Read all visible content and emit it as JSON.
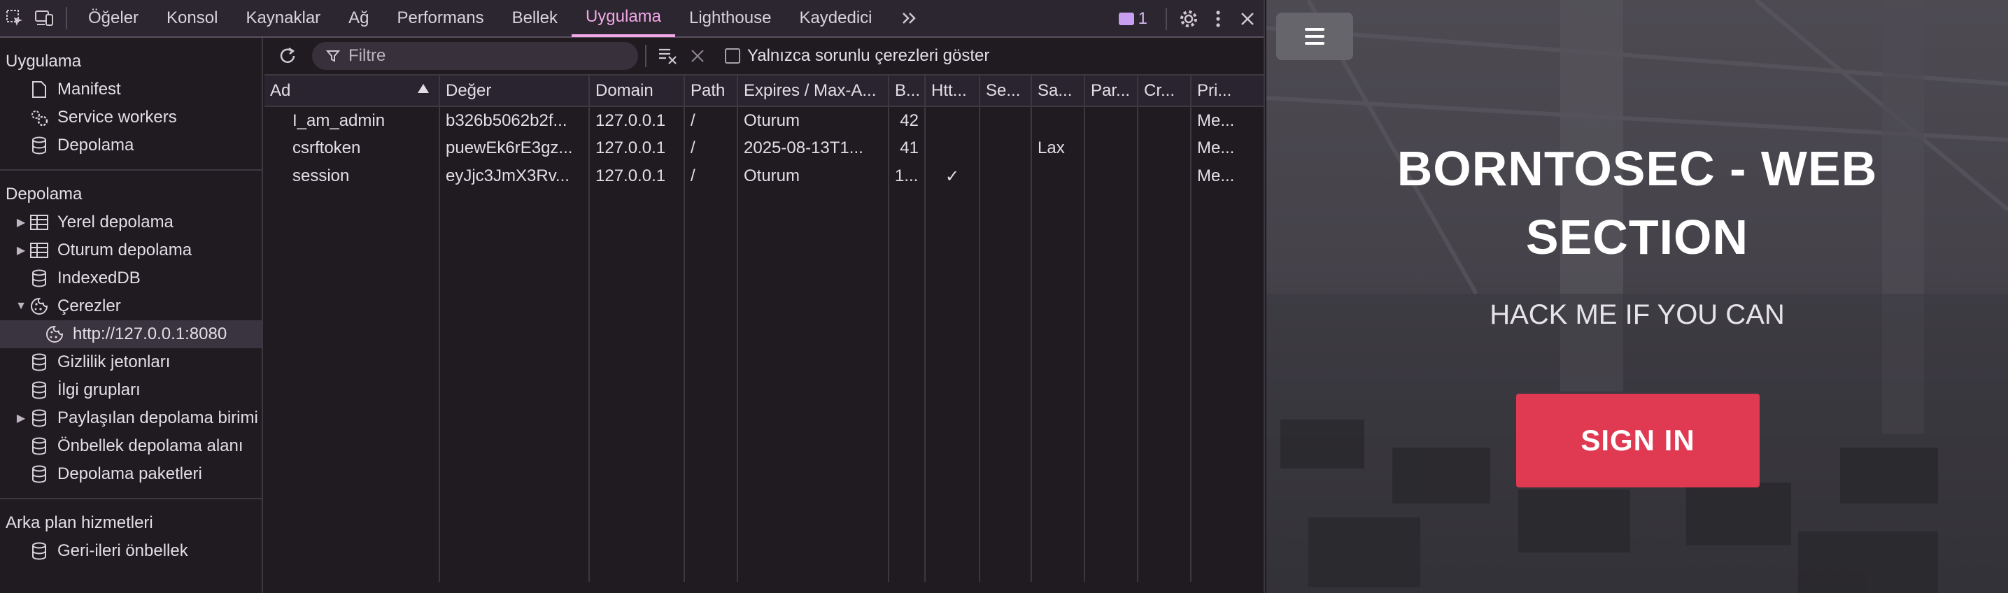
{
  "tabs": [
    "Öğeler",
    "Konsol",
    "Kaynaklar",
    "Ağ",
    "Performans",
    "Bellek",
    "Uygulama",
    "Lighthouse",
    "Kaydedici"
  ],
  "active_tab": "Uygulama",
  "issues_count": "1",
  "sidebar": {
    "sections": [
      {
        "title": "Uygulama",
        "items": [
          {
            "label": "Manifest",
            "icon": "document-icon"
          },
          {
            "label": "Service workers",
            "icon": "gears-icon"
          },
          {
            "label": "Depolama",
            "icon": "database-icon"
          }
        ]
      },
      {
        "title": "Depolama",
        "items": [
          {
            "label": "Yerel depolama",
            "icon": "table-icon",
            "arrow": "▶"
          },
          {
            "label": "Oturum depolama",
            "icon": "table-icon",
            "arrow": "▶"
          },
          {
            "label": "IndexedDB",
            "icon": "database-icon"
          },
          {
            "label": "Çerezler",
            "icon": "cookie-icon",
            "arrow": "▼"
          },
          {
            "label": "http://127.0.0.1:8080",
            "icon": "cookie-icon",
            "selected": true
          },
          {
            "label": "Gizlilik jetonları",
            "icon": "database-icon"
          },
          {
            "label": "İlgi grupları",
            "icon": "database-icon"
          },
          {
            "label": "Paylaşılan depolama birimi",
            "icon": "database-icon",
            "arrow": "▶"
          },
          {
            "label": "Önbellek depolama alanı",
            "icon": "database-icon"
          },
          {
            "label": "Depolama paketleri",
            "icon": "database-icon"
          }
        ]
      },
      {
        "title": "Arka plan hizmetleri",
        "items": [
          {
            "label": "Geri-ileri önbellek",
            "icon": "database-icon"
          }
        ]
      }
    ]
  },
  "toolbar": {
    "filter_placeholder": "Filtre",
    "only_issues_label": "Yalnızca sorunlu çerezleri göster"
  },
  "table": {
    "columns": [
      "Ad",
      "Değer",
      "Domain",
      "Path",
      "Expires / Max-A...",
      "B...",
      "Htt...",
      "Se...",
      "Sa...",
      "Par...",
      "Cr...",
      "Pri..."
    ],
    "rows": [
      [
        "I_am_admin",
        "b326b5062b2f...",
        "127.0.0.1",
        "/",
        "Oturum",
        "42",
        "",
        "",
        "",
        "",
        "",
        "Me..."
      ],
      [
        "csrftoken",
        "puewEk6rE3gz...",
        "127.0.0.1",
        "/",
        "2025-08-13T1...",
        "41",
        "",
        "",
        "Lax",
        "",
        "",
        "Me..."
      ],
      [
        "session",
        "eyJjc3JmX3Rv...",
        "127.0.0.1",
        "/",
        "Oturum",
        "1...",
        "✓",
        "",
        "",
        "",
        "",
        "Me..."
      ]
    ]
  },
  "preview": {
    "title": "BORNTOSEC - WEB SECTION",
    "subtitle": "HACK ME IF YOU CAN",
    "signin_label": "SIGN IN"
  }
}
